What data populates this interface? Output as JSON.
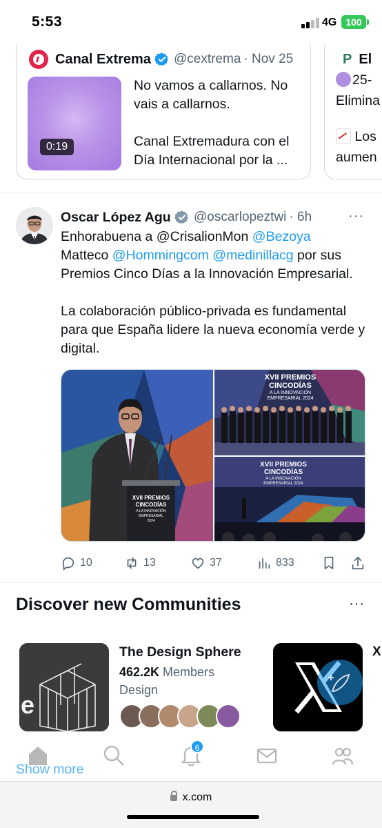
{
  "status_bar": {
    "time": "5:53",
    "network": "4G",
    "battery": "100"
  },
  "quoted_card": {
    "name": "Canal Extrema",
    "handle": "@cextrema",
    "date": "· Nov 25",
    "video_duration": "0:19",
    "text_1": "No vamos a callarnos. No vais a callarnos.",
    "text_2": "Canal Extremadura con el Día Internacional por la  ..."
  },
  "quoted_card_2": {
    "name": "El",
    "line_1": "25-",
    "line_2": "Elimina",
    "line_3": "Los",
    "line_4": "aumen"
  },
  "tweet": {
    "name": "Oscar López Agueda",
    "handle": "@oscarlopeztwi",
    "time": "· 6h",
    "more": "···",
    "line1_a": "Enhorabuena a @CrisalionMon ",
    "line1_b": "@Bezoya",
    "line2_a": "Matteco ",
    "line2_b": "@Hommingcom",
    "line2_c": " ",
    "line2_d": "@medinillacg",
    "line2_e": " por sus",
    "line3": "Premios Cinco Días a la Innovación Empresarial.",
    "para2": "La colaboración público-privada es fundamental para que España lidere la nueva economía verde y digital.",
    "banner_1": "XVII PREMIOS",
    "banner_2": "CINCODÍAS",
    "banner_3": "A LA INNOVACIÓN",
    "banner_4": "EMPRESARIAL 2024",
    "lectern_1": "XVII PREMIOS",
    "lectern_2": "CINCODÍAS",
    "lectern_3": "A LA INNOVACIÓN",
    "lectern_4": "EMPRESARIAL",
    "lectern_5": "2024",
    "banner2_1": "XVII PREMIOS",
    "banner2_2": "CINCODÍAS",
    "banner2_3": "A LA INNOVACIÓN",
    "banner2_4": "EMPRESARIAL 2024",
    "replies": "10",
    "retweets": "13",
    "likes": "37",
    "views": "833"
  },
  "communities": {
    "title": "Discover new Communities",
    "more": "···",
    "item_name": "The Design Sphere",
    "members_count": "462.2K",
    "members_label": " Members",
    "topic": "Design",
    "next_edge": "X"
  },
  "tabbar": {
    "notifications_badge": "6",
    "show_more": "Show more"
  },
  "browser": {
    "url": "x.com"
  },
  "colors": {
    "accent": "#1d9bf0",
    "text": "#0f1419",
    "muted": "#536471",
    "battery": "#34c759"
  }
}
